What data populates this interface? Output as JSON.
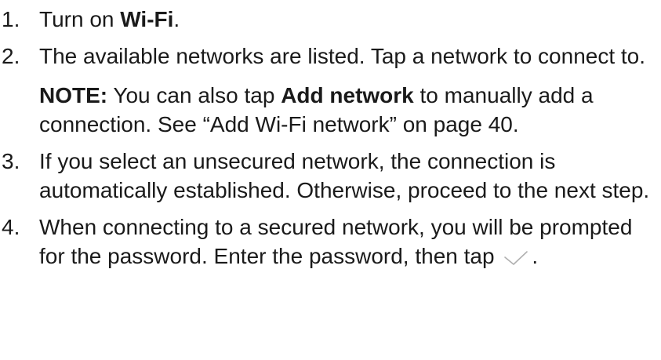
{
  "steps": [
    {
      "number": "1.",
      "pre": "Turn on ",
      "bold": "Wi-Fi",
      "post": "."
    },
    {
      "number": "2.",
      "text": "The available networks are listed. Tap a network to connect to.",
      "note": {
        "label": "NOTE:",
        "pre": " You can also tap ",
        "bold": "Add network",
        "post": " to manually add a connection. See “Add Wi-Fi network” on page 40."
      }
    },
    {
      "number": "3.",
      "text": "If you select an unsecured network, the connection is automatically established. Otherwise, proceed to the next step."
    },
    {
      "number": "4.",
      "text": "When connecting to a secured network, you will be prompted for the password. Enter the password, then tap",
      "icon": "checkmark-icon",
      "post": "."
    }
  ],
  "colors": {
    "text": "#1a1a1a",
    "icon": "#b0b0b0"
  }
}
